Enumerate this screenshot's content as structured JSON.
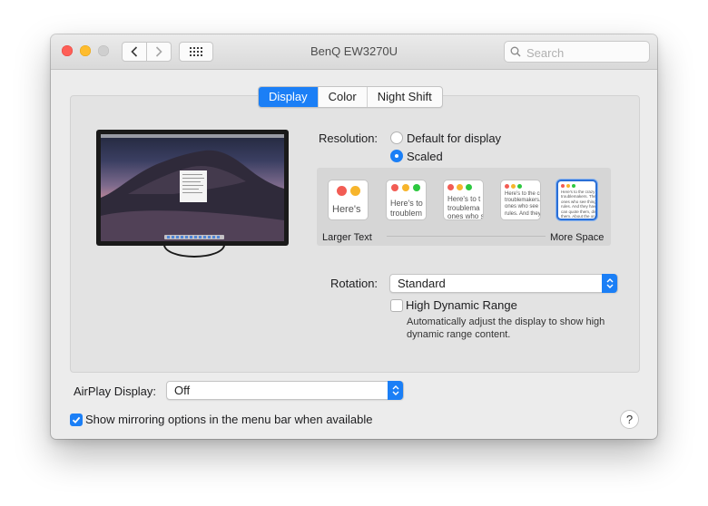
{
  "window": {
    "title": "BenQ EW3270U",
    "search_placeholder": "Search"
  },
  "tabs": [
    {
      "label": "Display",
      "active": true
    },
    {
      "label": "Color",
      "active": false
    },
    {
      "label": "Night Shift",
      "active": false
    }
  ],
  "resolution": {
    "label": "Resolution:",
    "options": [
      {
        "label": "Default for display",
        "selected": false
      },
      {
        "label": "Scaled",
        "selected": true
      }
    ],
    "scale_left_label": "Larger Text",
    "scale_right_label": "More Space",
    "thumbnails": [
      {
        "text": "Here's",
        "selected": false
      },
      {
        "text": "Here's to\ntroublem",
        "selected": false
      },
      {
        "text": "Here's to t\ntroublema\nones who se",
        "selected": false
      },
      {
        "text": "Here's to the cr\ntroublemakers.\nones who see th\nrules. And they",
        "selected": false
      },
      {
        "text": "Here's to the crazy one\ntroublemakers. The rou\nones who see things dif\nrules. And they have no\ncan quote them, disagr\nthem. About the only th\nBecause they change th",
        "selected": true
      }
    ]
  },
  "rotation": {
    "label": "Rotation:",
    "value": "Standard"
  },
  "hdr": {
    "label": "High Dynamic Range",
    "checked": false,
    "description_line1": "Automatically adjust the display to show high",
    "description_line2": "dynamic range content."
  },
  "airplay": {
    "label": "AirPlay Display:",
    "value": "Off"
  },
  "mirroring": {
    "label": "Show mirroring options in the menu bar when available",
    "checked": true
  },
  "help_label": "?",
  "colors": {
    "accent": "#1b7ff6",
    "close": "#fe5f57",
    "minimize": "#febc2e"
  }
}
